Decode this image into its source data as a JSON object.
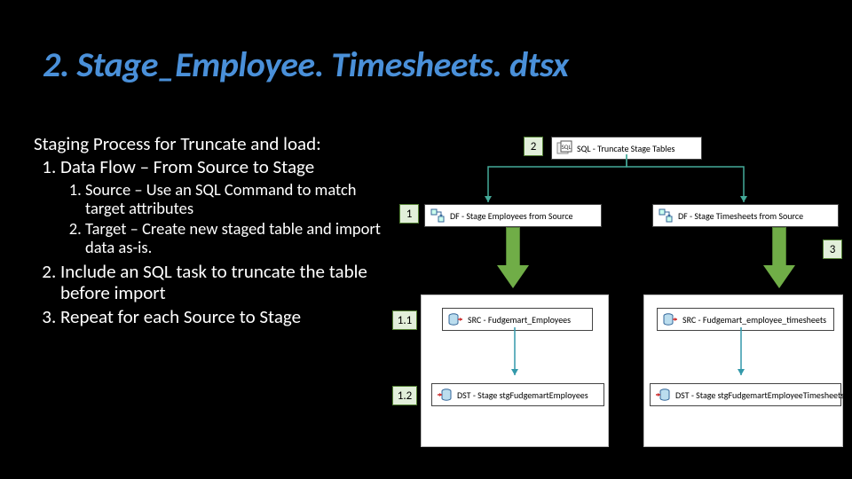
{
  "title": "2. Stage_Employee. Timesheets. dtsx",
  "intro": "Staging Process for Truncate and load:",
  "steps": {
    "s1": "Data Flow – From Source to Stage",
    "s1_1": "Source – Use an SQL Command to match target attributes",
    "s1_2": "Target – Create new staged table and import data as-is.",
    "s2": "Include an SQL task to truncate the table before import",
    "s3": "Repeat for each Source to Stage"
  },
  "callouts": {
    "c1": "1",
    "c2": "2",
    "c3": "3",
    "c1_1": "1.1",
    "c1_2": "1.2"
  },
  "tasks": {
    "sqlTruncate": "SQL - Truncate Stage Tables",
    "dfEmployees": "DF - Stage Employees from Source",
    "dfTimesheets": "DF - Stage Timesheets from Source",
    "srcEmp": "SRC - Fudgemart_Employees",
    "srcTs": "SRC - Fudgemart_employee_timesheets",
    "dstEmp": "DST - Stage stgFudgemartEmployees",
    "dstTs": "DST - Stage stgFudgemartEmployeeTimesheets"
  },
  "colors": {
    "title": "#4a90d9",
    "arrow": "#70ad47",
    "calloutBg": "#e2efda",
    "calloutBorder": "#548235"
  }
}
